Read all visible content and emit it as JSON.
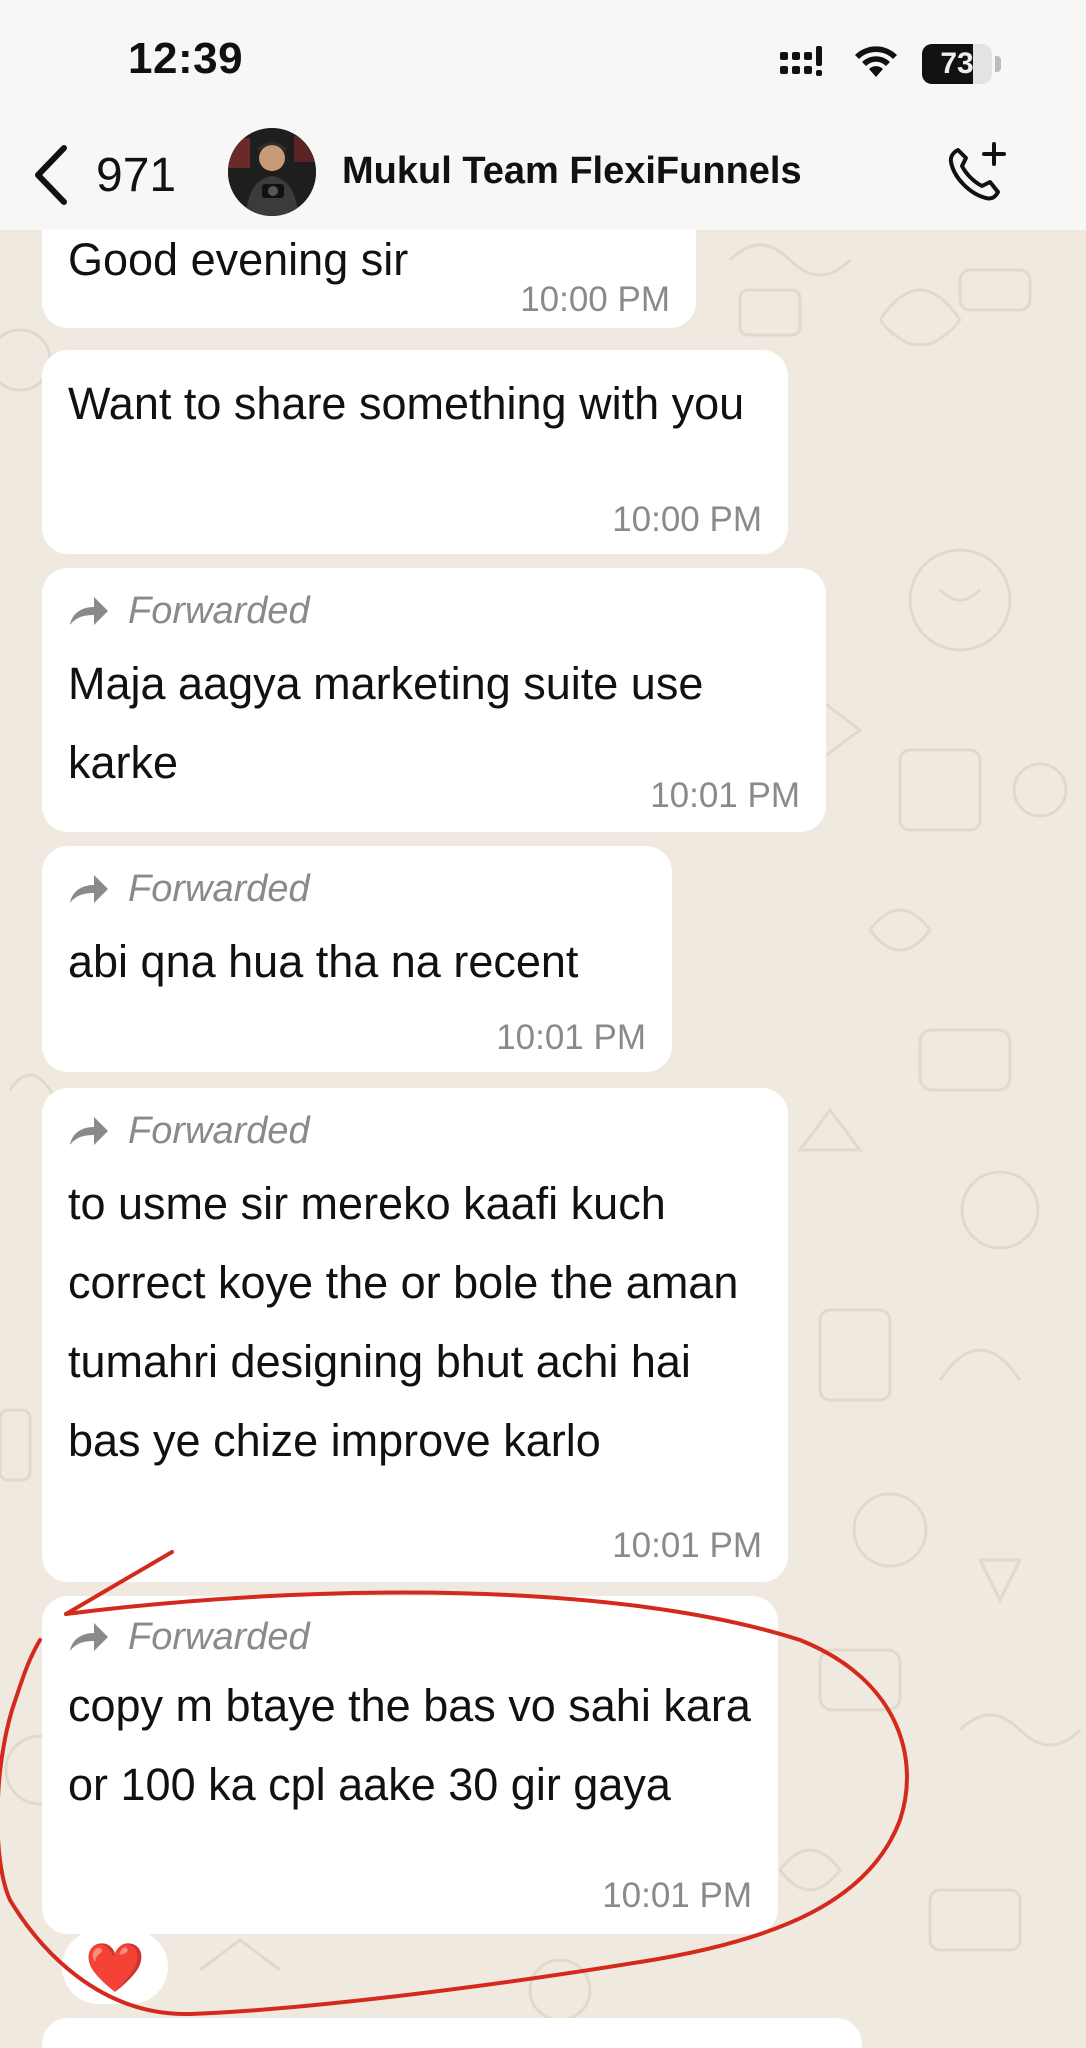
{
  "status_bar": {
    "time": "12:39",
    "battery_level": "73",
    "icons": [
      "signal-icon",
      "wifi-icon",
      "battery-icon"
    ]
  },
  "header": {
    "back_count": "971",
    "title": "Mukul Team FlexiFunnels",
    "icons": [
      "chevron-left-icon",
      "avatar",
      "add-call-icon"
    ]
  },
  "messages": [
    {
      "forwarded": false,
      "text": "Good evening sir",
      "time": "10:00 PM"
    },
    {
      "forwarded": false,
      "text": "Want to share something with you",
      "time": "10:00 PM"
    },
    {
      "forwarded": true,
      "forward_label": "Forwarded",
      "text": "Maja aagya marketing suite use karke",
      "time": "10:01 PM"
    },
    {
      "forwarded": true,
      "forward_label": "Forwarded",
      "text": "abi qna hua tha na recent",
      "time": "10:01 PM"
    },
    {
      "forwarded": true,
      "forward_label": "Forwarded",
      "text": "to usme sir mereko kaafi kuch correct koye the or bole the aman tumahri designing bhut achi hai bas ye chize improve karlo",
      "time": "10:01 PM"
    },
    {
      "forwarded": true,
      "forward_label": "Forwarded",
      "text": "copy m btaye the bas vo sahi kara or 100 ka cpl aake 30 gir gaya",
      "time": "10:01 PM",
      "reaction": "❤️"
    }
  ],
  "colors": {
    "wallpaper": "#efe9df",
    "bubble": "#ffffff",
    "annotation": "#d42a1e",
    "meta_text": "#8a8a8a"
  }
}
